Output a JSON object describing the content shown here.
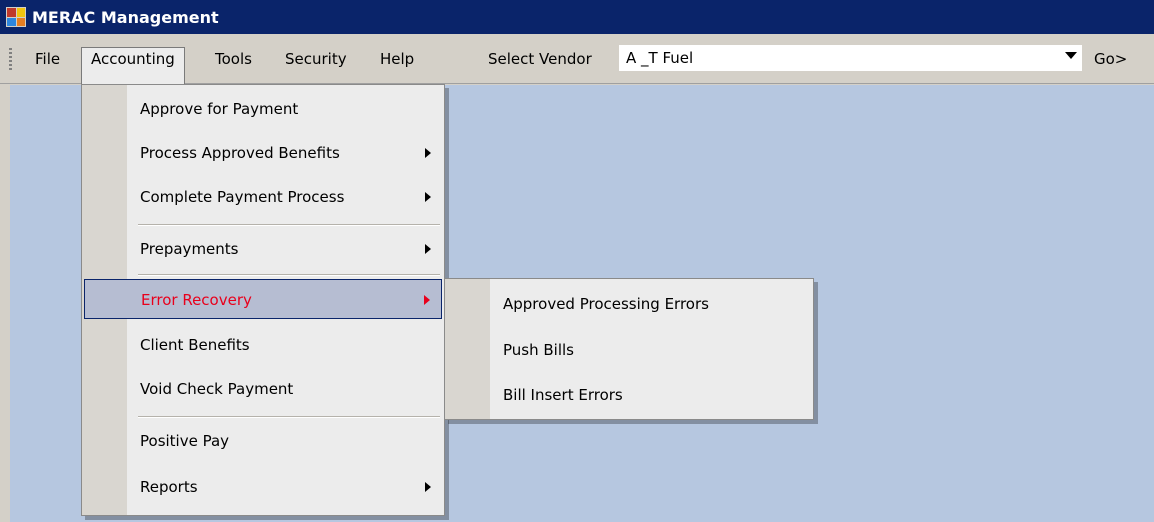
{
  "window": {
    "title": "MERAC Management"
  },
  "menubar": {
    "items": [
      {
        "label": "File"
      },
      {
        "label": "Accounting"
      },
      {
        "label": "Tools"
      },
      {
        "label": "Security"
      },
      {
        "label": "Help"
      }
    ],
    "vendor_label": "Select Vendor",
    "vendor_value": "A _T Fuel",
    "go_label": "Go>"
  },
  "accounting_menu": {
    "items": [
      {
        "label": "Approve for Payment",
        "has_submenu": false
      },
      {
        "label": "Process Approved Benefits",
        "has_submenu": true
      },
      {
        "label": "Complete Payment Process",
        "has_submenu": true
      },
      {
        "label": "Prepayments",
        "has_submenu": true
      },
      {
        "label": "Error Recovery",
        "has_submenu": true,
        "highlighted": true
      },
      {
        "label": "Client Benefits",
        "has_submenu": false
      },
      {
        "label": "Void Check Payment",
        "has_submenu": false
      },
      {
        "label": "Positive Pay",
        "has_submenu": false
      },
      {
        "label": "Reports",
        "has_submenu": true
      }
    ]
  },
  "error_recovery_submenu": {
    "items": [
      {
        "label": "Approved Processing Errors"
      },
      {
        "label": "Push Bills"
      },
      {
        "label": "Bill Insert Errors"
      }
    ]
  },
  "colors": {
    "titlebar": "#0a246a",
    "workspace": "#b6c7e0",
    "highlight_text": "#e8001c"
  }
}
